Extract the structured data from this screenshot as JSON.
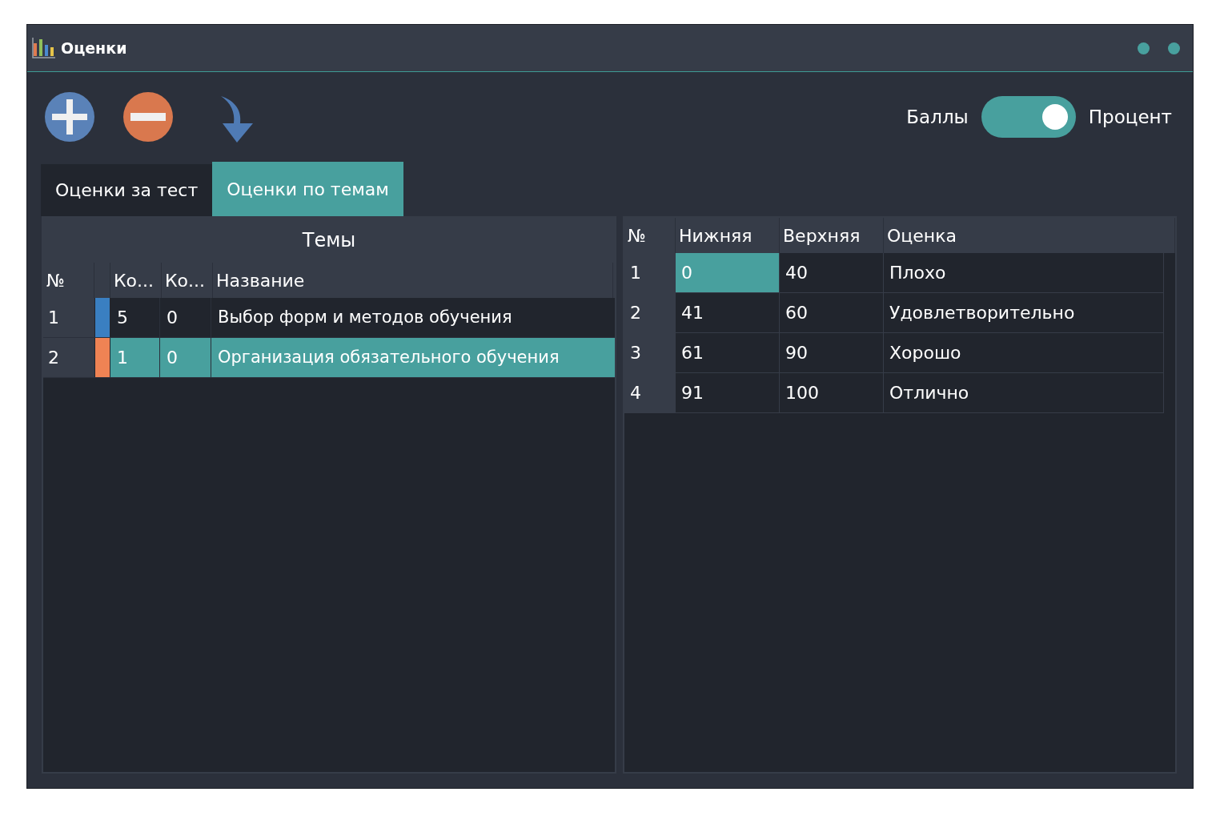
{
  "window": {
    "title": "Оценки"
  },
  "toolbar": {
    "switch": {
      "left_label": "Баллы",
      "right_label": "Процент",
      "on": true
    }
  },
  "tabs": [
    {
      "label": "Оценки за тест",
      "selected": false
    },
    {
      "label": "Оценки по темам",
      "selected": true
    }
  ],
  "topics_table": {
    "title": "Темы",
    "columns": [
      "№",
      "Ко...",
      "Ко...",
      "Название"
    ],
    "rows": [
      {
        "number": "1",
        "color": "#3a7fc1",
        "count_1": "5",
        "count_2": "0",
        "name": "Выбор форм и методов обучения",
        "selected": false
      },
      {
        "number": "2",
        "color": "#ef8354",
        "count_1": "1",
        "count_2": "0",
        "name": "Организация обязательного обучения",
        "selected": true
      }
    ]
  },
  "grades_table": {
    "columns": [
      "№",
      "Нижняя",
      "Верхняя",
      "Оценка"
    ],
    "rows": [
      {
        "cells": [
          {
            "text": "1",
            "selected": false
          },
          {
            "text": "0",
            "selected": true
          },
          {
            "text": "40",
            "selected": false
          },
          {
            "text": "Плохо",
            "selected": false
          }
        ]
      },
      {
        "cells": [
          {
            "text": "2",
            "selected": false
          },
          {
            "text": "41",
            "selected": false
          },
          {
            "text": "60",
            "selected": false
          },
          {
            "text": "Удовлетворительно",
            "selected": false
          }
        ]
      },
      {
        "cells": [
          {
            "text": "3",
            "selected": false
          },
          {
            "text": "61",
            "selected": false
          },
          {
            "text": "90",
            "selected": false
          },
          {
            "text": "Хорошо",
            "selected": false
          }
        ]
      },
      {
        "cells": [
          {
            "text": "4",
            "selected": false
          },
          {
            "text": "91",
            "selected": false
          },
          {
            "text": "100",
            "selected": false
          },
          {
            "text": "Отлично",
            "selected": false
          }
        ]
      }
    ]
  }
}
